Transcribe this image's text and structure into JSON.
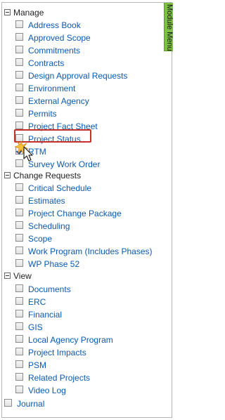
{
  "module_menu_tab": "Module Menu",
  "groups": {
    "manage": "Manage",
    "change_requests": "Change Requests",
    "view": "View"
  },
  "manage_items": [
    {
      "label": "Address Book",
      "checked": false
    },
    {
      "label": "Approved Scope",
      "checked": false
    },
    {
      "label": "Commitments",
      "checked": false
    },
    {
      "label": "Contracts",
      "checked": false
    },
    {
      "label": "Design Approval Requests",
      "checked": false
    },
    {
      "label": "Environment",
      "checked": false
    },
    {
      "label": "External Agency",
      "checked": false
    },
    {
      "label": "Permits",
      "checked": false
    },
    {
      "label": "Project Fact Sheet",
      "checked": false
    },
    {
      "label": "Project Status",
      "checked": false
    },
    {
      "label": "RTM",
      "checked": true
    },
    {
      "label": "Survey Work Order",
      "checked": false
    }
  ],
  "change_request_items": [
    {
      "label": "Critical Schedule",
      "checked": false
    },
    {
      "label": "Estimates",
      "checked": false
    },
    {
      "label": "Project Change Package",
      "checked": false
    },
    {
      "label": "Scheduling",
      "checked": false
    },
    {
      "label": "Scope",
      "checked": false
    },
    {
      "label": "Work Program (Includes Phases)",
      "checked": false
    },
    {
      "label": "WP Phase 52",
      "checked": false
    }
  ],
  "view_items": [
    {
      "label": "Documents",
      "checked": false
    },
    {
      "label": "ERC",
      "checked": false
    },
    {
      "label": "Financial",
      "checked": false
    },
    {
      "label": "GIS",
      "checked": false
    },
    {
      "label": "Local Agency Program",
      "checked": false
    },
    {
      "label": "Project Impacts",
      "checked": false
    },
    {
      "label": "PSM",
      "checked": false
    },
    {
      "label": "Related Projects",
      "checked": false
    },
    {
      "label": "Video Log",
      "checked": false
    }
  ],
  "journal": {
    "label": "Journal",
    "checked": false
  },
  "colors": {
    "link": "#0b59b0",
    "tab_green": "#7dc142",
    "highlight_red": "#c8302a"
  }
}
